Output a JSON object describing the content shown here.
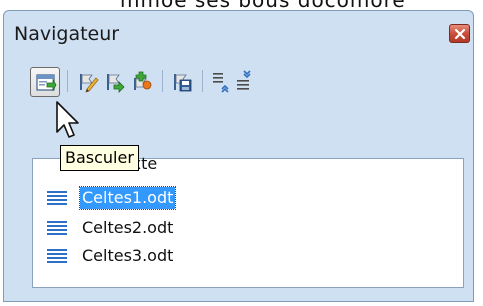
{
  "top_fragment": "mmoe ses bous docomore",
  "panel": {
    "title": "Navigateur",
    "colors": {
      "panel_bg": "#cfe0f2",
      "close_red": "#c84a37",
      "selection": "#3399ff"
    }
  },
  "toolbar": {
    "buttons": [
      {
        "icon": "toggle-icon"
      },
      {
        "icon": "pencil-icon"
      },
      {
        "icon": "flag-arrow-icon"
      },
      {
        "icon": "insert-document-icon"
      },
      {
        "icon": "save-as-icon"
      },
      {
        "icon": "demote-level-icon"
      },
      {
        "icon": "promote-level-icon"
      }
    ]
  },
  "tooltip": {
    "text": "Basculer"
  },
  "list": {
    "category": "Texte",
    "items": [
      {
        "label": "Celtes1.odt",
        "selected": true
      },
      {
        "label": "Celtes2.odt",
        "selected": false
      },
      {
        "label": "Celtes3.odt",
        "selected": false
      }
    ]
  }
}
